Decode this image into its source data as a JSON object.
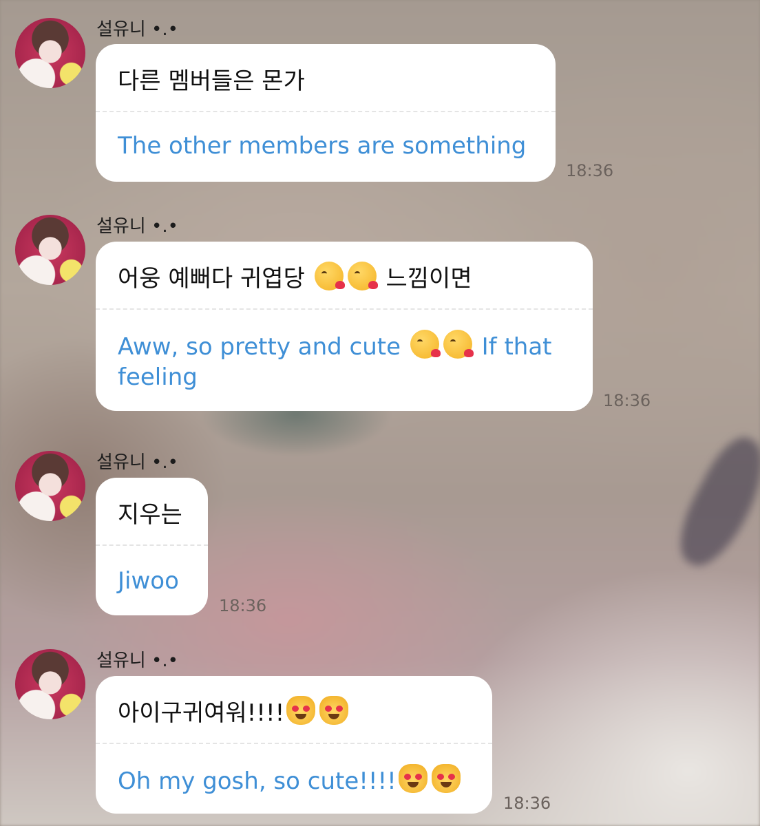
{
  "messages": [
    {
      "sender": "설유니 •.•",
      "original": "다른 멤버들은 몬가",
      "translation": "The other members are something",
      "time": "18:36"
    },
    {
      "sender": "설유니 •.•",
      "original_parts": [
        "어웅 예뻐다 귀엽당",
        "느낌이면"
      ],
      "original_emojis": [
        "kissing-face-emoji",
        "kissing-face-emoji"
      ],
      "translation_parts": [
        "Aww, so pretty and cute",
        "If that feeling"
      ],
      "translation_emojis": [
        "kissing-face-emoji",
        "kissing-face-emoji"
      ],
      "time": "18:36"
    },
    {
      "sender": "설유니 •.•",
      "original": "지우는",
      "translation": "Jiwoo",
      "time": "18:36"
    },
    {
      "sender": "설유니 •.•",
      "original": "아이구귀여워!!!!",
      "original_emojis": [
        "heart-eyes-cat-emoji",
        "heart-eyes-cat-emoji"
      ],
      "translation": "Oh my gosh, so cute!!!!",
      "translation_emojis": [
        "heart-eyes-cat-emoji",
        "heart-eyes-cat-emoji"
      ],
      "time": "18:36"
    }
  ]
}
